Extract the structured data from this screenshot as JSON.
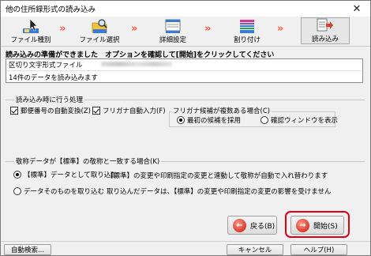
{
  "window": {
    "title": "他の住所録形式の読み込み",
    "close_glyph": "✕"
  },
  "steps": [
    {
      "label": "ファイル種別",
      "icon": "cursor-step-icon"
    },
    {
      "label": "ファイル選択",
      "icon": "folder-search-icon"
    },
    {
      "label": "詳細設定",
      "icon": "settings-window-icon"
    },
    {
      "label": "割り付け",
      "icon": "columns-assign-icon"
    },
    {
      "label": "読み込み",
      "icon": "import-icon"
    }
  ],
  "arrow_glyph": "»",
  "instruction": "読み込みの準備ができました　オプションを確認して[開始]をクリックしてください",
  "info": {
    "line1": "区切り文字形式ファイル",
    "line2": "14件のデータを読み込みます"
  },
  "processing": {
    "group_label": "読み込み時に行う処理",
    "postal_check": "郵便番号の自動変換(Z)",
    "furigana_check": "フリガナ自動入力(F)",
    "furigana_group_label": "フリガナ候補が複数ある場合(C)",
    "radio_first": "最初の候補を採用",
    "radio_confirm": "確認ウィンドウを表示"
  },
  "category": {
    "group_label": "敬称データが【標準】の敬称と一致する場合(K)",
    "radio_standard": "【標準】データとして取り込む",
    "radio_as_is": "データそのものを取り込む",
    "note_standard": "【標準】の変更や印刷指定の変更と連動して敬称が自動で入れ替わります",
    "note_as_is": "取り込んだデータは、【標準】の変更や印刷指定の変更の影響を受けません"
  },
  "buttons": {
    "back": "戻る(B)",
    "start": "開始(S)",
    "auto_search": "自動検索...",
    "cancel": "キャンセル",
    "help": "ヘルプ(H)"
  },
  "colors": {
    "accent_red": "#e00010",
    "arrow": "#ff5a3c"
  }
}
